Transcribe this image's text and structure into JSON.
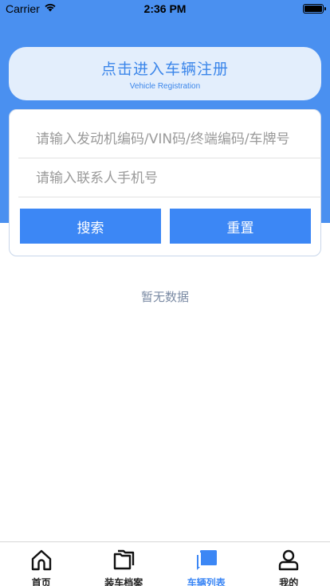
{
  "status_bar": {
    "carrier": "Carrier",
    "time": "2:36 PM"
  },
  "register": {
    "title": "点击进入车辆注册",
    "subtitle": "Vehicle Registration"
  },
  "search": {
    "vehicle_placeholder": "请输入发动机编码/VIN码/终端编码/车牌号",
    "phone_placeholder": "请输入联系人手机号",
    "vehicle_value": "",
    "phone_value": "",
    "search_label": "搜索",
    "reset_label": "重置"
  },
  "empty_text": "暂无数据",
  "tabbar": {
    "items": [
      {
        "label": "首页",
        "icon": "home-icon",
        "active": false
      },
      {
        "label": "装车档案",
        "icon": "folder-icon",
        "active": false
      },
      {
        "label": "车辆列表",
        "icon": "chat-icon",
        "active": true
      },
      {
        "label": "我的",
        "icon": "user-icon",
        "active": false
      }
    ]
  },
  "colors": {
    "header_blue": "#4a90f0",
    "accent": "#3c87f5",
    "register_bg": "#e3eefc"
  }
}
